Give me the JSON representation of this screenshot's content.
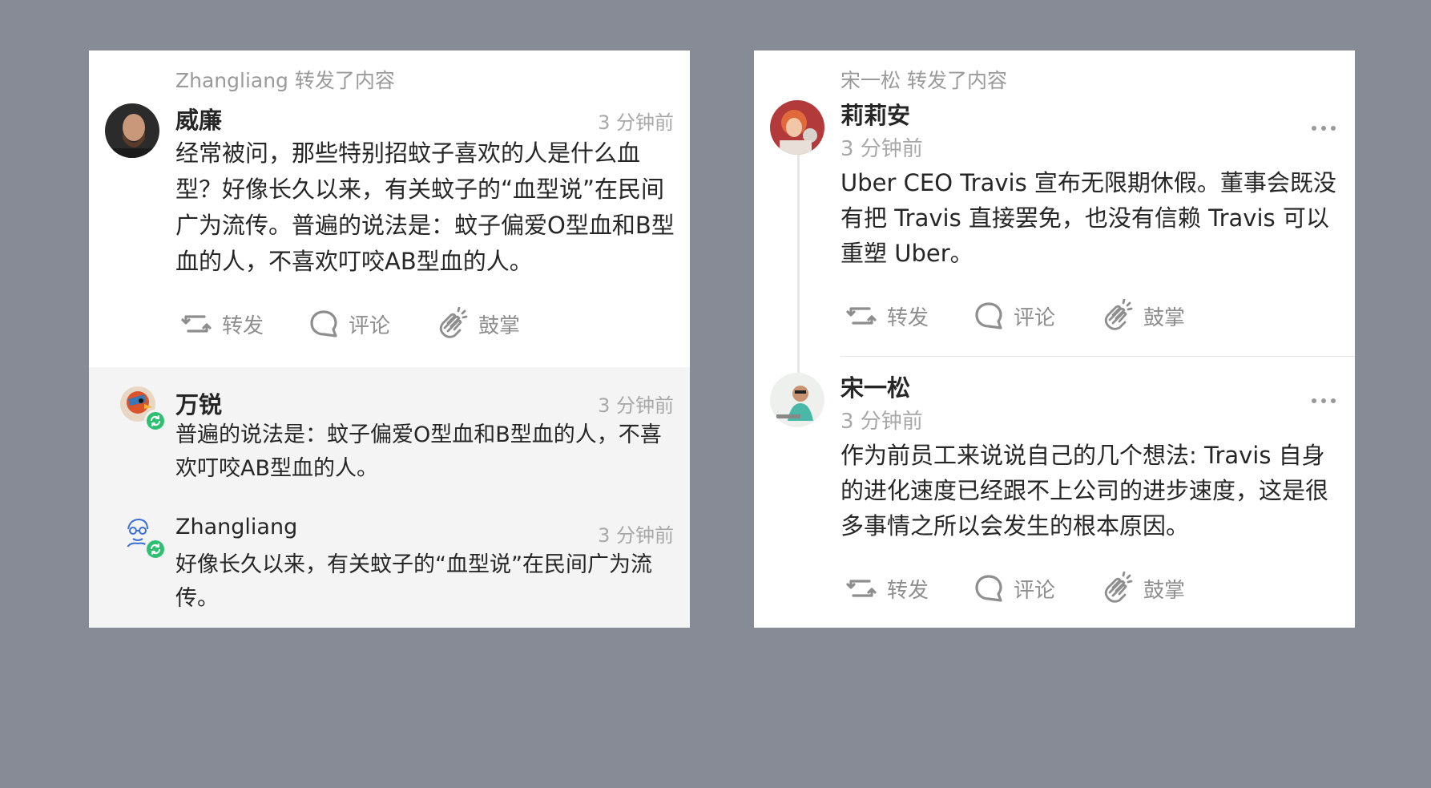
{
  "left_card": {
    "reposter_line": "Zhangliang 转发了内容",
    "post": {
      "author": "威廉",
      "time": "3 分钟前",
      "content": "经常被问，那些特别招蚊子喜欢的人是什么血型？好像长久以来，有关蚊子的“血型说”在民间广为流传。普遍的说法是：蚊子偏爱O型血和B型血的人，不喜欢叮咬AB型血的人。"
    },
    "actions": {
      "repost": "转发",
      "comment": "评论",
      "clap": "鼓掌"
    },
    "replies": [
      {
        "author": "万锐",
        "time": "3 分钟前",
        "content": "普遍的说法是：蚊子偏爱O型血和B型血的人，不喜欢叮咬AB型血的人。"
      },
      {
        "author": "Zhangliang",
        "time": "3 分钟前",
        "content": "好像长久以来，有关蚊子的“血型说”在民间广为流传。"
      }
    ]
  },
  "right_card": {
    "reposter_line": "宋一松 转发了内容",
    "posts": [
      {
        "author": "莉莉安",
        "time": "3 分钟前",
        "content": "Uber CEO Travis 宣布无限期休假。董事会既没有把 Travis 直接罢免，也没有信赖 Travis 可以重塑 Uber。"
      },
      {
        "author": "宋一松",
        "time": "3 分钟前",
        "content": "作为前员工来说说自己的几个想法: Travis 自身的进化速度已经跟不上公司的进步速度，这是很多事情之所以会发生的根本原因。"
      }
    ],
    "actions": {
      "repost": "转发",
      "comment": "评论",
      "clap": "鼓掌"
    }
  },
  "colors": {
    "background": "#868b96",
    "card": "#ffffff",
    "thread_bg": "#f4f4f4",
    "meta_text": "#a8a8a8",
    "repost_badge": "#2fbf71"
  },
  "icons": [
    "repost-icon",
    "comment-icon",
    "clap-icon",
    "more-icon",
    "repost-badge-icon"
  ]
}
